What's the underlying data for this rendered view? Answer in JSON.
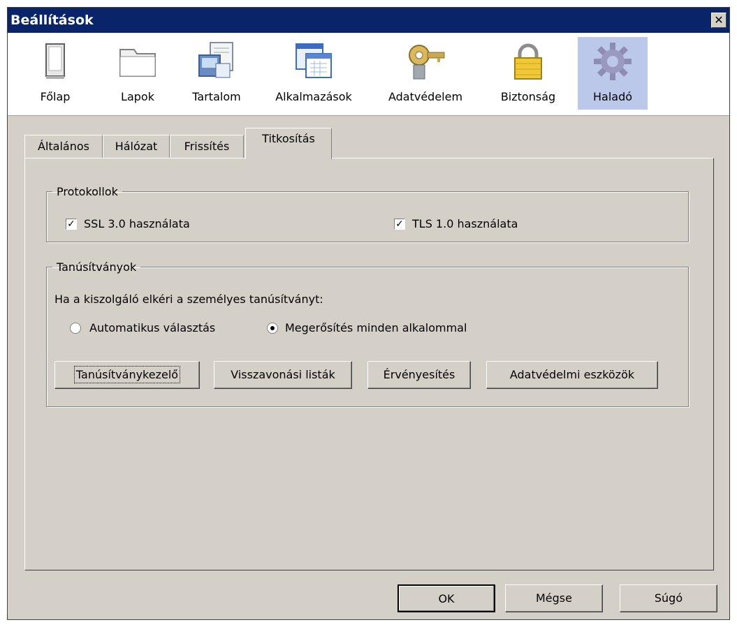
{
  "window": {
    "title": "Beállítások",
    "close_glyph": "✕"
  },
  "toolbar": {
    "items": [
      {
        "label": "Főlap",
        "icon": "main-page-icon"
      },
      {
        "label": "Lapok",
        "icon": "tabs-icon"
      },
      {
        "label": "Tartalom",
        "icon": "content-icon"
      },
      {
        "label": "Alkalmazások",
        "icon": "applications-icon"
      },
      {
        "label": "Adatvédelem",
        "icon": "privacy-key-icon"
      },
      {
        "label": "Biztonság",
        "icon": "security-lock-icon"
      },
      {
        "label": "Haladó",
        "icon": "advanced-gear-icon"
      }
    ],
    "selected_index": 6,
    "selected_color": "#bcc8ea"
  },
  "tabs": {
    "items": [
      "Általános",
      "Hálózat",
      "Frissítés",
      "Titkosítás"
    ],
    "active_index": 3
  },
  "protocols": {
    "legend": "Protokollok",
    "ssl": {
      "label": "SSL 3.0 használata",
      "checked": true
    },
    "tls": {
      "label": "TLS 1.0 használata",
      "checked": true
    }
  },
  "certificates": {
    "legend": "Tanúsítványok",
    "prompt": "Ha a kiszolgáló elkéri a személyes tanúsítványt:",
    "radio_auto": {
      "label": "Automatikus választás",
      "selected": false
    },
    "radio_confirm": {
      "label": "Megerősítés minden alkalommal",
      "selected": true
    },
    "buttons": [
      "Tanúsítványkezelő",
      "Visszavonási listák",
      "Érvényesítés",
      "Adatvédelmi eszközök"
    ]
  },
  "footer": {
    "ok": "OK",
    "cancel": "Mégse",
    "help": "Súgó"
  },
  "colors": {
    "title_bar": "#0a246a",
    "dialog_bg": "#d4d0c8"
  }
}
